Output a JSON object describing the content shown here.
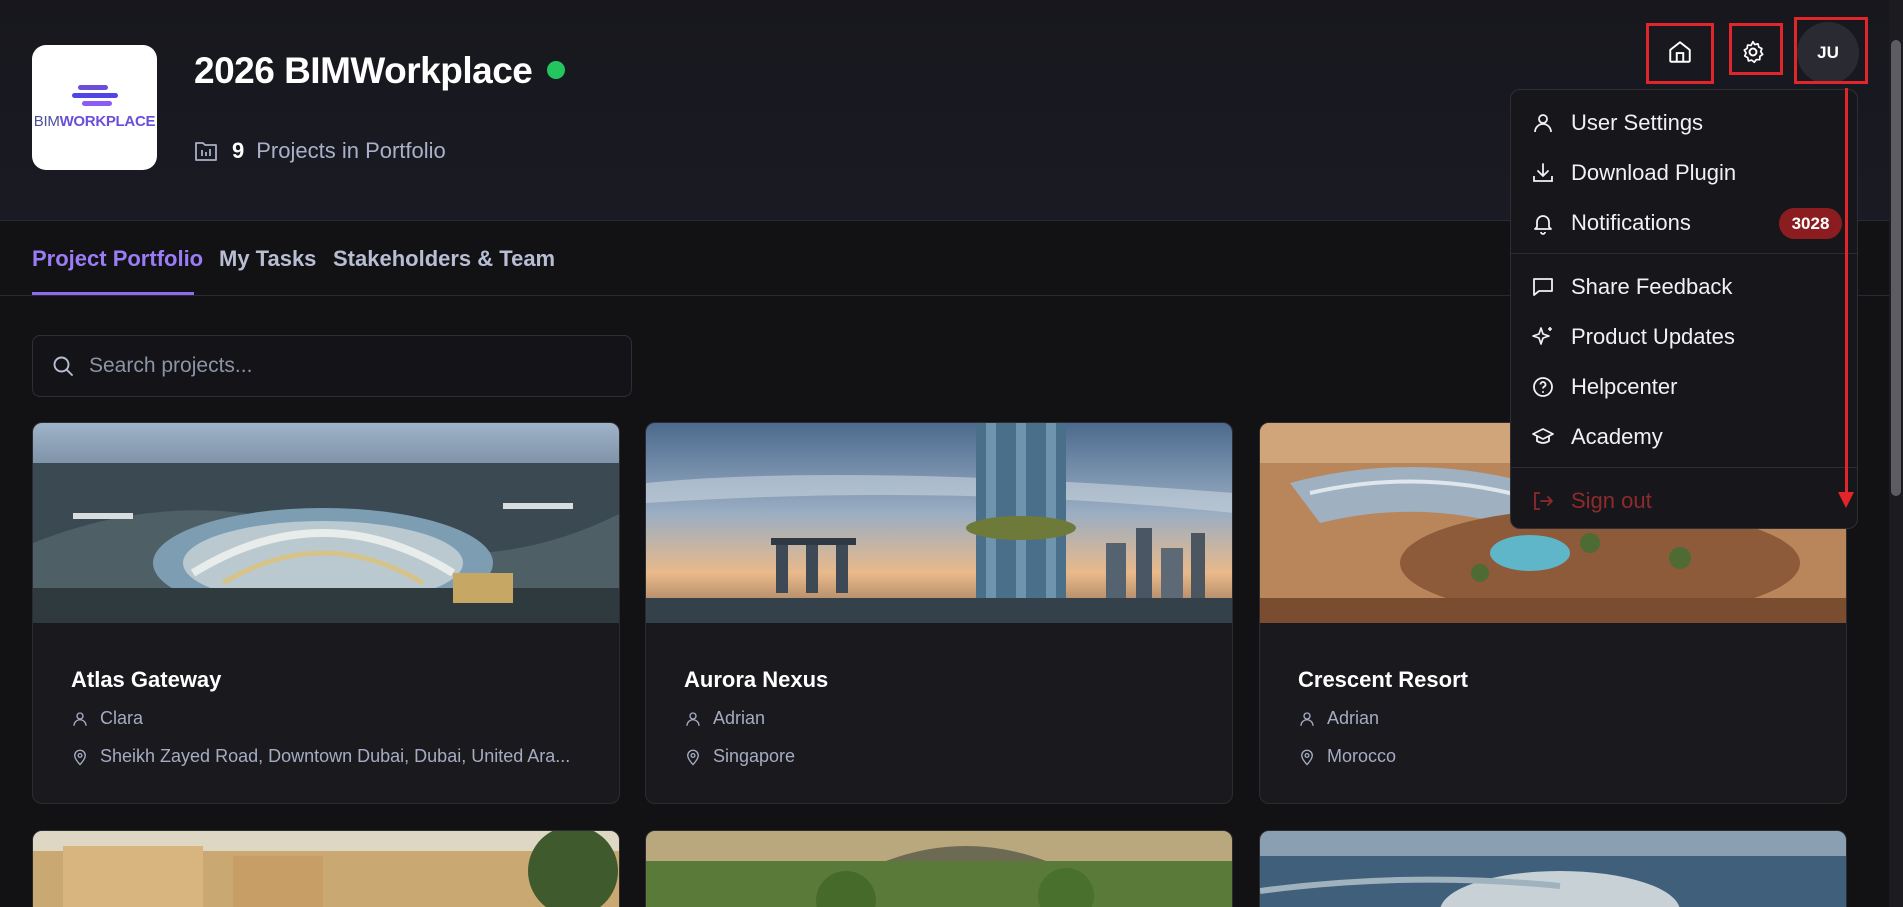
{
  "app": {
    "logo_text_left": "BIM",
    "logo_text_right": "WORKPLACE",
    "title": "2026 BIMWorkplace",
    "project_count": "9",
    "project_count_label": "Projects in Portfolio"
  },
  "header": {
    "avatar_initials": "JU"
  },
  "tabs": [
    {
      "label": "Project Portfolio",
      "active": true
    },
    {
      "label": "My Tasks",
      "active": false
    },
    {
      "label": "Stakeholders & Team",
      "active": false
    }
  ],
  "search": {
    "placeholder": "Search projects..."
  },
  "projects": [
    {
      "name": "Atlas Gateway",
      "owner": "Clara",
      "location": "Sheikh Zayed Road, Downtown Dubai, Dubai, United Ara..."
    },
    {
      "name": "Aurora Nexus",
      "owner": "Adrian",
      "location": "Singapore"
    },
    {
      "name": "Crescent Resort",
      "owner": "Adrian",
      "location": "Morocco"
    }
  ],
  "user_menu": {
    "items": [
      {
        "label": "User Settings",
        "icon": "user-icon"
      },
      {
        "label": "Download Plugin",
        "icon": "download-icon"
      },
      {
        "label": "Notifications",
        "icon": "bell-icon",
        "badge": "3028"
      },
      {
        "label": "Share Feedback",
        "icon": "message-icon"
      },
      {
        "label": "Product Updates",
        "icon": "sparkles-icon"
      },
      {
        "label": "Helpcenter",
        "icon": "help-circle-icon"
      },
      {
        "label": "Academy",
        "icon": "graduation-cap-icon"
      }
    ],
    "sign_out": "Sign out"
  },
  "colors": {
    "accent": "#9b7cf6",
    "status_online": "#22c55e",
    "badge_bg": "#8b1d20",
    "annotation_red": "#e0252b"
  }
}
